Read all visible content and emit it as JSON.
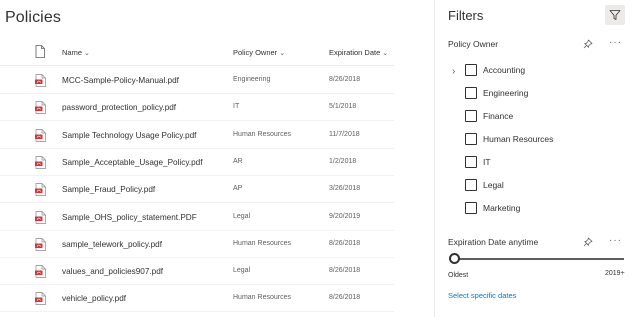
{
  "library": {
    "title": "Policies",
    "columns": {
      "name": "Name",
      "owner": "Policy Owner",
      "expiration": "Expiration Date"
    },
    "files": [
      {
        "name": "MCC-Sample-Policy-Manual.pdf",
        "owner": "Engineering",
        "expiration": "8/26/2018"
      },
      {
        "name": "password_protection_policy.pdf",
        "owner": "IT",
        "expiration": "5/1/2018"
      },
      {
        "name": "Sample Technology Usage Policy.pdf",
        "owner": "Human Resources",
        "expiration": "11/7/2018"
      },
      {
        "name": "Sample_Acceptable_Usage_Policy.pdf",
        "owner": "AR",
        "expiration": "1/2/2018"
      },
      {
        "name": "Sample_Fraud_Policy.pdf",
        "owner": "AP",
        "expiration": "3/26/2018"
      },
      {
        "name": "Sample_OHS_policy_statement.PDF",
        "owner": "Legal",
        "expiration": "9/20/2019"
      },
      {
        "name": "sample_telework_policy.pdf",
        "owner": "Human Resources",
        "expiration": "8/26/2018"
      },
      {
        "name": "values_and_policies907.pdf",
        "owner": "Legal",
        "expiration": "8/26/2018"
      },
      {
        "name": "vehicle_policy.pdf",
        "owner": "Human Resources",
        "expiration": "8/26/2018"
      }
    ]
  },
  "filters": {
    "title": "Filters",
    "policy_owner": {
      "label": "Policy Owner",
      "options": [
        "Accounting",
        "Engineering",
        "Finance",
        "Human Resources",
        "IT",
        "Legal",
        "Marketing"
      ]
    },
    "expiration": {
      "label": "Expiration Date anytime",
      "min_label": "Oldest",
      "max_label": "2019+",
      "link": "Select specific dates"
    }
  },
  "colors": {
    "accent": "#0078d4",
    "pdf_red": "#d13438",
    "text": "#323130",
    "secondary_text": "#605e5c"
  },
  "icons": {
    "file_type": "pdf-file-icon",
    "header_file": "document-icon",
    "filter": "filter-icon",
    "pin": "pin-icon",
    "more": "more-icon",
    "expand": "chevron-right-icon"
  }
}
